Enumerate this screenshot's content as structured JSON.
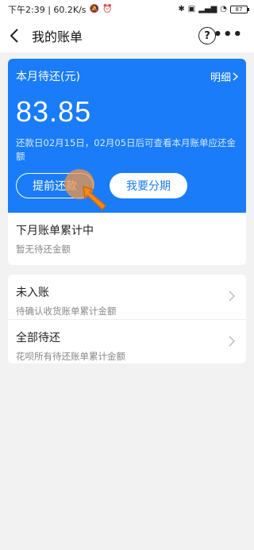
{
  "status_bar": {
    "left_text": "下午2:39 | 60.2K/s",
    "battery": "87"
  },
  "nav": {
    "title": "我的账单"
  },
  "bill_card": {
    "title": "本月待还(元)",
    "detail_link": "明细",
    "amount": "83.85",
    "note": "还款日02月15日，02月05日后可查看本月账单应还金额",
    "early_repay_button": "提前还款",
    "installment_button": "我要分期"
  },
  "next_month": {
    "title": "下月账单累计中",
    "subtitle": "暂无待还金额"
  },
  "list": [
    {
      "title": "未入账",
      "subtitle": "待确认收货账单累计金额"
    },
    {
      "title": "全部待还",
      "subtitle": "花呗所有待还账单累计金额"
    }
  ],
  "colors": {
    "brand_blue": "#1a7cf9",
    "background": "#f2f2f2",
    "tap_highlight": "#f0964a"
  }
}
